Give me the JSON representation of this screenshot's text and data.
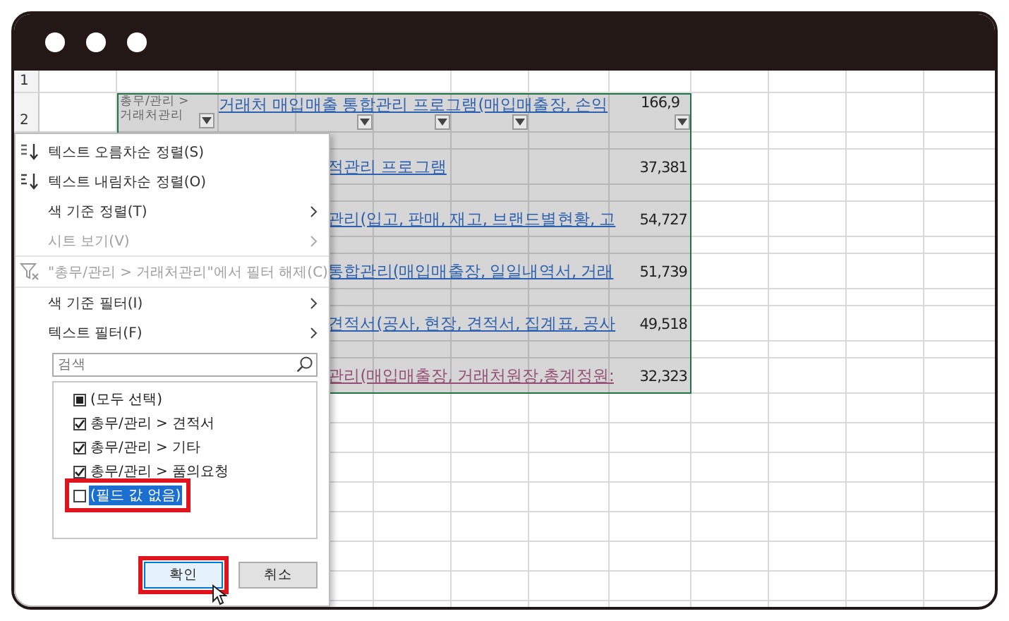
{
  "sheet": {
    "row_numbers": [
      "1",
      "2"
    ],
    "header_row": {
      "category": "총무/관리 > 거래처관리",
      "title": "거래처 매입매출 통합관리 프로그램(매입매출장, 손익",
      "value": "166,9"
    },
    "rows": [
      {
        "title": "적관리 프로그램",
        "value": "37,381",
        "visited": false
      },
      {
        "title": "관리(입고, 판매, 재고, 브랜드별현황, 고",
        "value": "54,727",
        "visited": false
      },
      {
        "title": "통합관리(매입매출장, 일일내역서, 거래",
        "value": "51,739",
        "visited": false
      },
      {
        "title": "견적서(공사, 현장, 견적서, 집계표, 공사",
        "value": "49,518",
        "visited": false
      },
      {
        "title": "관리(매입매출장, 거래처원장,총계정원:",
        "value": "32,323",
        "visited": true
      }
    ]
  },
  "filter_menu": {
    "items": [
      {
        "kind": "sort-asc",
        "label": "텍스트 오름차순 정렬(S)",
        "disabled": false
      },
      {
        "kind": "sort-desc",
        "label": "텍스트 내림차순 정렬(O)",
        "disabled": false
      },
      {
        "kind": "submenu",
        "label": "색 기준 정렬(T)",
        "disabled": false
      },
      {
        "kind": "submenu",
        "label": "시트 보기(V)",
        "disabled": true
      },
      {
        "kind": "clear",
        "label": "\"총무/관리 > 거래처관리\"에서 필터 해제(C)",
        "disabled": true
      },
      {
        "kind": "submenu",
        "label": "색 기준 필터(I)",
        "disabled": false
      },
      {
        "kind": "submenu",
        "label": "텍스트 필터(F)",
        "disabled": false
      }
    ],
    "search": {
      "placeholder": "검색"
    },
    "values": [
      {
        "label": "(모두 선택)",
        "checked": false,
        "indeterminate": true,
        "selected": false,
        "highlighted": false
      },
      {
        "label": "총무/관리 > 견적서",
        "checked": true,
        "indeterminate": false,
        "selected": false,
        "highlighted": false
      },
      {
        "label": "총무/관리 > 기타",
        "checked": true,
        "indeterminate": false,
        "selected": false,
        "highlighted": false
      },
      {
        "label": "총무/관리 > 품의요청",
        "checked": true,
        "indeterminate": false,
        "selected": false,
        "highlighted": false
      },
      {
        "label": "(필드 값 없음)",
        "checked": false,
        "indeterminate": false,
        "selected": true,
        "highlighted": true
      }
    ],
    "buttons": [
      {
        "label": "확인",
        "highlighted": true
      },
      {
        "label": "취소",
        "highlighted": false
      }
    ]
  }
}
